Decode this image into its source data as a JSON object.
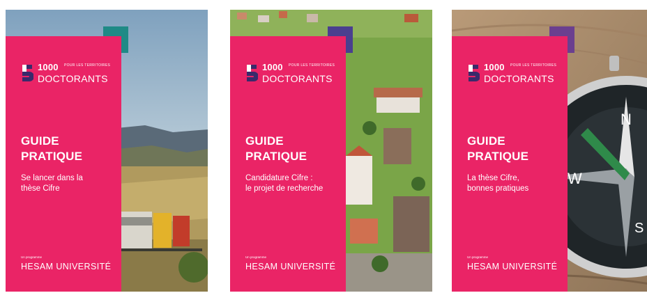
{
  "cards": [
    {
      "logo_number": "1000",
      "logo_tagline": "pour les territoires",
      "logo_word": "DOCTORANTS",
      "title_line1": "GUIDE",
      "title_line2": "PRATIQUE",
      "subtitle_line1": "Se lancer dans la",
      "subtitle_line2": "thèse Cifre",
      "program_label": "Un programme",
      "university": "HESAM UNIVERSITÉ",
      "accent_color": "#1f8a86",
      "photo": "train-in-countryside"
    },
    {
      "logo_number": "1000",
      "logo_tagline": "pour les territoires",
      "logo_word": "DOCTORANTS",
      "title_line1": "GUIDE",
      "title_line2": "PRATIQUE",
      "subtitle_line1": "Candidature Cifre :",
      "subtitle_line2": "le projet de recherche",
      "program_label": "Un programme",
      "university": "HESAM UNIVERSITÉ",
      "accent_color": "#4a3f8f",
      "photo": "aerial-village"
    },
    {
      "logo_number": "1000",
      "logo_tagline": "pour les territoires",
      "logo_word": "DOCTORANTS",
      "title_line1": "GUIDE",
      "title_line2": "PRATIQUE",
      "subtitle_line1": "La thèse Cifre,",
      "subtitle_line2": "bonnes pratiques",
      "program_label": "Un programme",
      "university": "HESAM UNIVERSITÉ",
      "accent_color": "#6b3f8f",
      "photo": "compass-on-wood"
    }
  ],
  "colors": {
    "panel_pink": "#ea2466",
    "logo_dark": "#3a2a6b"
  }
}
